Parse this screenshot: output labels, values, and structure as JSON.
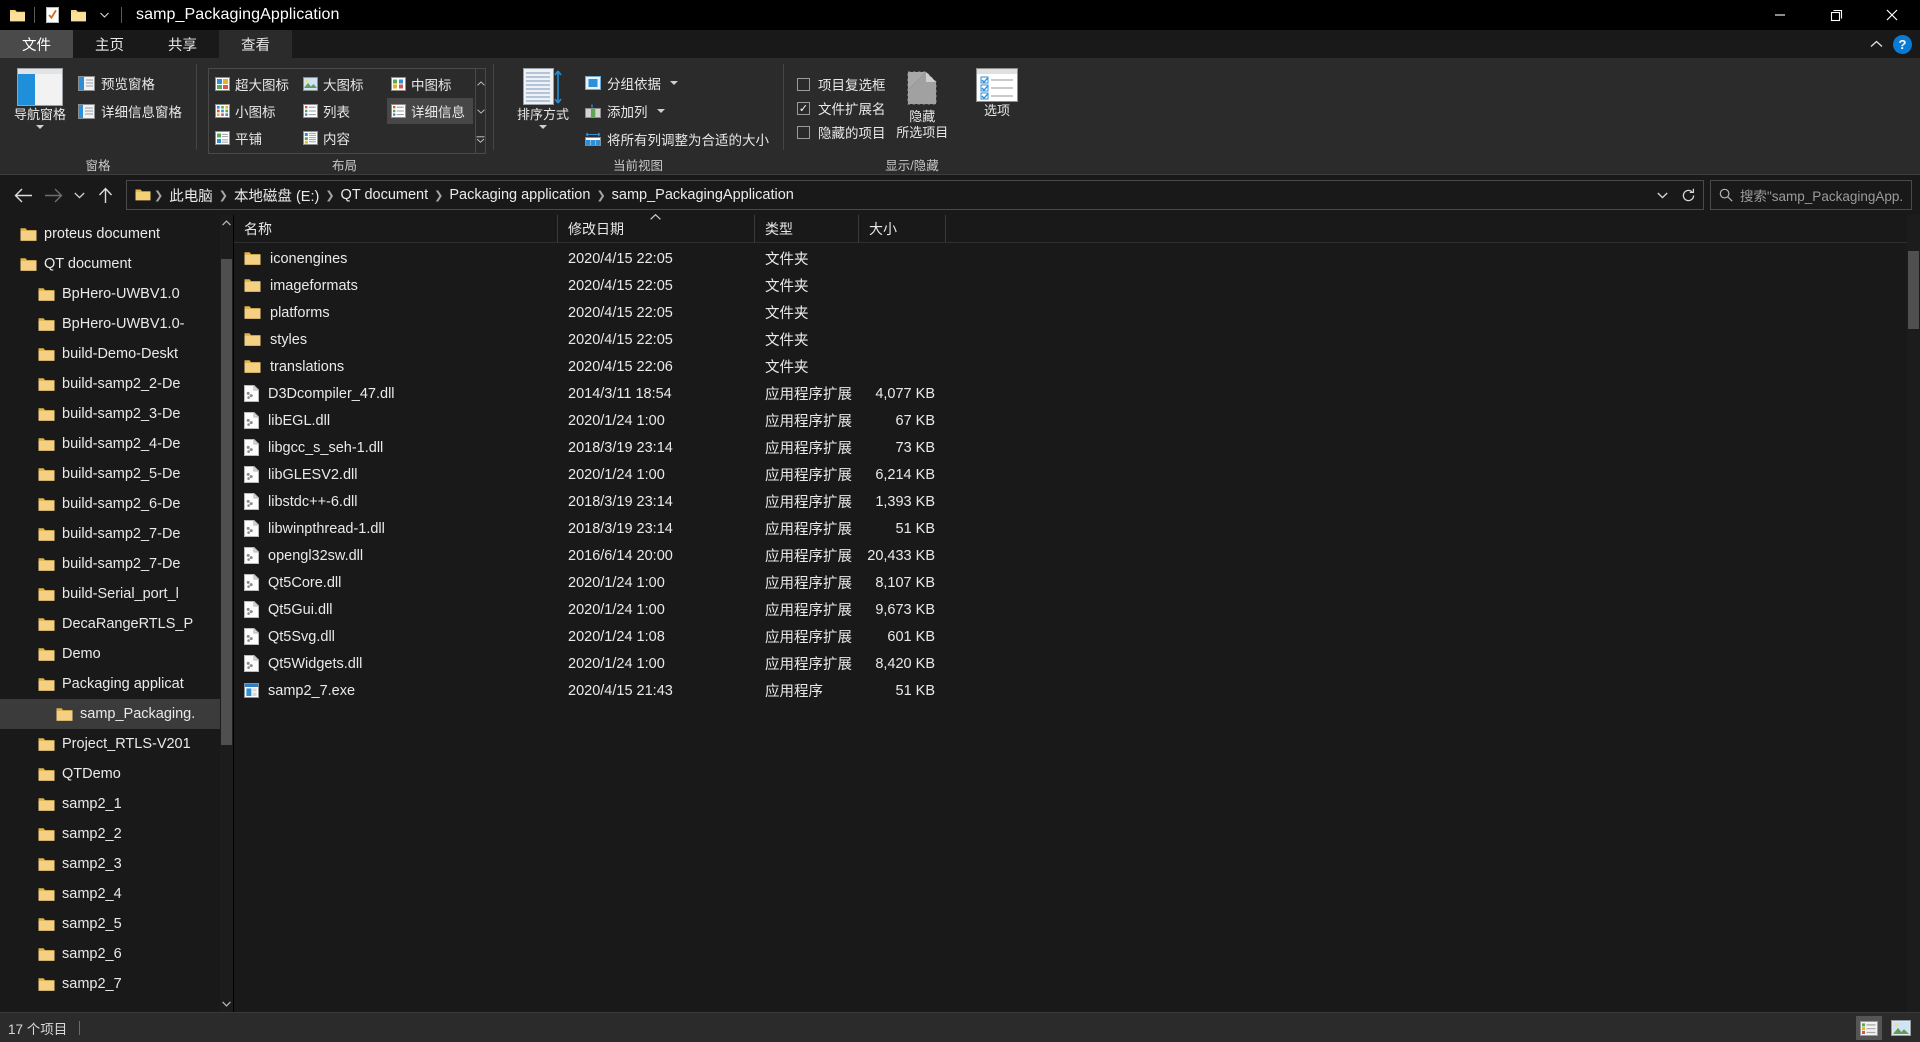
{
  "window": {
    "title": "samp_PackagingApplication",
    "quick_access": [
      "folder-icon",
      "properties-icon",
      "new-folder-icon"
    ],
    "controls": {
      "minimize": "minimize-icon",
      "maximize": "maximize-icon",
      "close": "close-icon"
    }
  },
  "ribbon": {
    "tabs": [
      {
        "label": "文件",
        "style": "file"
      },
      {
        "label": "主页",
        "style": "normal"
      },
      {
        "label": "共享",
        "style": "normal"
      },
      {
        "label": "查看",
        "style": "active"
      }
    ],
    "collapse_label": "chevron-up-icon",
    "help_label": "?",
    "groups": [
      {
        "label": "窗格",
        "big_button": {
          "label": "导航窗格",
          "icon": "navigation-pane-icon"
        },
        "small_buttons": [
          {
            "label": "预览窗格",
            "icon": "preview-pane-icon"
          },
          {
            "label": "详细信息窗格",
            "icon": "details-pane-icon"
          }
        ]
      },
      {
        "label": "布局",
        "gallery": [
          {
            "label": "超大图标",
            "icon": "extra-large-icons-icon",
            "selected": false
          },
          {
            "label": "大图标",
            "icon": "large-icons-icon",
            "selected": false
          },
          {
            "label": "中图标",
            "icon": "medium-icons-icon",
            "selected": false
          },
          {
            "label": "小图标",
            "icon": "small-icons-icon",
            "selected": false
          },
          {
            "label": "列表",
            "icon": "list-view-icon",
            "selected": false
          },
          {
            "label": "详细信息",
            "icon": "details-view-icon",
            "selected": true
          },
          {
            "label": "平铺",
            "icon": "tiles-view-icon",
            "selected": false
          },
          {
            "label": "内容",
            "icon": "content-view-icon",
            "selected": false
          }
        ]
      },
      {
        "label": "当前视图",
        "big_button": {
          "label": "排序方式",
          "icon": "sort-by-icon"
        },
        "small_buttons": [
          {
            "label": "分组依据",
            "icon": "group-by-icon",
            "dropdown": true
          },
          {
            "label": "添加列",
            "icon": "add-columns-icon",
            "dropdown": true
          },
          {
            "label": "将所有列调整为合适的大小",
            "icon": "size-all-columns-icon",
            "dropdown": false
          }
        ]
      },
      {
        "label": "显示/隐藏",
        "checkboxes": [
          {
            "label": "项目复选框",
            "checked": false
          },
          {
            "label": "文件扩展名",
            "checked": true
          },
          {
            "label": "隐藏的项目",
            "checked": false
          }
        ],
        "hide_button": {
          "line1": "隐藏",
          "line2": "所选项目",
          "icon": "hide-selected-icon"
        },
        "options_button": {
          "label": "选项",
          "icon": "options-icon"
        }
      }
    ]
  },
  "navigation": {
    "back": "back-arrow-icon",
    "forward": "forward-arrow-icon",
    "recent": "chevron-down-icon",
    "up": "up-arrow-icon",
    "breadcrumb_icon": "folder-icon",
    "breadcrumbs": [
      "此电脑",
      "本地磁盘 (E:)",
      "QT document",
      "Packaging application",
      "samp_PackagingApplication"
    ],
    "history_dropdown": "chevron-down-icon",
    "refresh": "refresh-icon",
    "search": {
      "icon": "search-icon",
      "placeholder": "搜索\"samp_PackagingApp..."
    }
  },
  "sidebar": {
    "scroll_up": "chevron-up-icon",
    "scroll_down": "chevron-down-icon",
    "items": [
      {
        "label": "proteus document",
        "indent": 1,
        "selected": false
      },
      {
        "label": "QT document",
        "indent": 1,
        "selected": false
      },
      {
        "label": "BpHero-UWBV1.0",
        "indent": 2,
        "selected": false
      },
      {
        "label": "BpHero-UWBV1.0-",
        "indent": 2,
        "selected": false
      },
      {
        "label": "build-Demo-Deskt",
        "indent": 2,
        "selected": false
      },
      {
        "label": "build-samp2_2-De",
        "indent": 2,
        "selected": false
      },
      {
        "label": "build-samp2_3-De",
        "indent": 2,
        "selected": false
      },
      {
        "label": "build-samp2_4-De",
        "indent": 2,
        "selected": false
      },
      {
        "label": "build-samp2_5-De",
        "indent": 2,
        "selected": false
      },
      {
        "label": "build-samp2_6-De",
        "indent": 2,
        "selected": false
      },
      {
        "label": "build-samp2_7-De",
        "indent": 2,
        "selected": false
      },
      {
        "label": "build-samp2_7-De",
        "indent": 2,
        "selected": false
      },
      {
        "label": "build-Serial_port_l",
        "indent": 2,
        "selected": false
      },
      {
        "label": "DecaRangeRTLS_P",
        "indent": 2,
        "selected": false
      },
      {
        "label": "Demo",
        "indent": 2,
        "selected": false
      },
      {
        "label": "Packaging applicat",
        "indent": 2,
        "selected": false
      },
      {
        "label": "samp_Packaging.",
        "indent": 3,
        "selected": true
      },
      {
        "label": "Project_RTLS-V201",
        "indent": 2,
        "selected": false
      },
      {
        "label": "QTDemo",
        "indent": 2,
        "selected": false
      },
      {
        "label": "samp2_1",
        "indent": 2,
        "selected": false
      },
      {
        "label": "samp2_2",
        "indent": 2,
        "selected": false
      },
      {
        "label": "samp2_3",
        "indent": 2,
        "selected": false
      },
      {
        "label": "samp2_4",
        "indent": 2,
        "selected": false
      },
      {
        "label": "samp2_5",
        "indent": 2,
        "selected": false
      },
      {
        "label": "samp2_6",
        "indent": 2,
        "selected": false
      },
      {
        "label": "samp2_7",
        "indent": 2,
        "selected": false
      }
    ]
  },
  "filelist": {
    "columns": [
      {
        "key": "name",
        "label": "名称",
        "sorted": "asc"
      },
      {
        "key": "date",
        "label": "修改日期"
      },
      {
        "key": "type",
        "label": "类型"
      },
      {
        "key": "size",
        "label": "大小"
      }
    ],
    "rows": [
      {
        "name": "iconengines",
        "date": "2020/4/15 22:05",
        "type": "文件夹",
        "size": "",
        "icon": "folder-icon"
      },
      {
        "name": "imageformats",
        "date": "2020/4/15 22:05",
        "type": "文件夹",
        "size": "",
        "icon": "folder-icon"
      },
      {
        "name": "platforms",
        "date": "2020/4/15 22:05",
        "type": "文件夹",
        "size": "",
        "icon": "folder-icon"
      },
      {
        "name": "styles",
        "date": "2020/4/15 22:05",
        "type": "文件夹",
        "size": "",
        "icon": "folder-icon"
      },
      {
        "name": "translations",
        "date": "2020/4/15 22:06",
        "type": "文件夹",
        "size": "",
        "icon": "folder-icon"
      },
      {
        "name": "D3Dcompiler_47.dll",
        "date": "2014/3/11 18:54",
        "type": "应用程序扩展",
        "size": "4,077 KB",
        "icon": "dll-file-icon"
      },
      {
        "name": "libEGL.dll",
        "date": "2020/1/24 1:00",
        "type": "应用程序扩展",
        "size": "67 KB",
        "icon": "dll-file-icon"
      },
      {
        "name": "libgcc_s_seh-1.dll",
        "date": "2018/3/19 23:14",
        "type": "应用程序扩展",
        "size": "73 KB",
        "icon": "dll-file-icon"
      },
      {
        "name": "libGLESV2.dll",
        "date": "2020/1/24 1:00",
        "type": "应用程序扩展",
        "size": "6,214 KB",
        "icon": "dll-file-icon"
      },
      {
        "name": "libstdc++-6.dll",
        "date": "2018/3/19 23:14",
        "type": "应用程序扩展",
        "size": "1,393 KB",
        "icon": "dll-file-icon"
      },
      {
        "name": "libwinpthread-1.dll",
        "date": "2018/3/19 23:14",
        "type": "应用程序扩展",
        "size": "51 KB",
        "icon": "dll-file-icon"
      },
      {
        "name": "opengl32sw.dll",
        "date": "2016/6/14 20:00",
        "type": "应用程序扩展",
        "size": "20,433 KB",
        "icon": "dll-file-icon"
      },
      {
        "name": "Qt5Core.dll",
        "date": "2020/1/24 1:00",
        "type": "应用程序扩展",
        "size": "8,107 KB",
        "icon": "dll-file-icon"
      },
      {
        "name": "Qt5Gui.dll",
        "date": "2020/1/24 1:00",
        "type": "应用程序扩展",
        "size": "9,673 KB",
        "icon": "dll-file-icon"
      },
      {
        "name": "Qt5Svg.dll",
        "date": "2020/1/24 1:08",
        "type": "应用程序扩展",
        "size": "601 KB",
        "icon": "dll-file-icon"
      },
      {
        "name": "Qt5Widgets.dll",
        "date": "2020/1/24 1:00",
        "type": "应用程序扩展",
        "size": "8,420 KB",
        "icon": "dll-file-icon"
      },
      {
        "name": "samp2_7.exe",
        "date": "2020/4/15 21:43",
        "type": "应用程序",
        "size": "51 KB",
        "icon": "exe-file-icon"
      }
    ]
  },
  "statusbar": {
    "item_count": "17 个项目",
    "views": [
      {
        "name": "details-view-toggle",
        "active": true
      },
      {
        "name": "large-icons-view-toggle",
        "active": false
      }
    ]
  }
}
